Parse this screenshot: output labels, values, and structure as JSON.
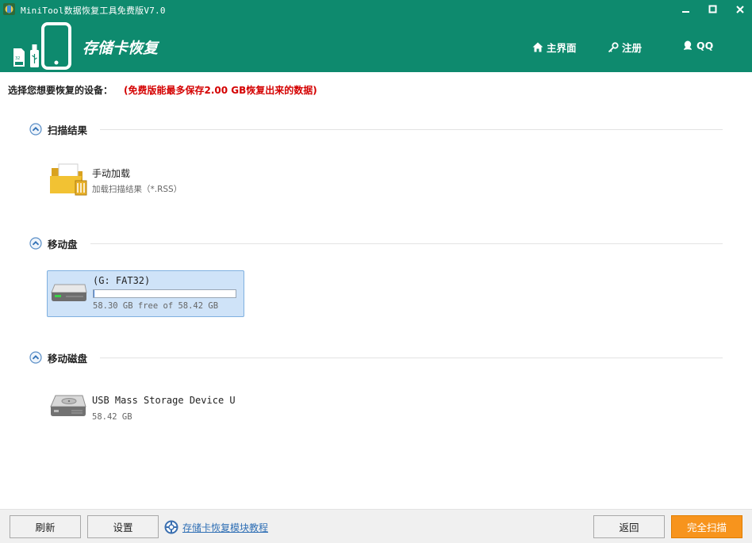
{
  "window": {
    "title": "MiniTool数据恢复工具免费版V7.0"
  },
  "header": {
    "app_title": "存储卡恢复",
    "nav": {
      "home": "主界面",
      "register": "注册",
      "qq": "QQ"
    }
  },
  "prompt": {
    "label": "选择您想要恢复的设备：",
    "limit_notice": "(免费版能最多保存2.00 GB恢复出来的数据)"
  },
  "sections": {
    "scan_results": {
      "title": "扫描结果",
      "item": {
        "name": "手动加载",
        "description": "加载扫描结果（*.RSS）",
        "icon": "folder-icon"
      }
    },
    "removable": {
      "title": "移动盘",
      "item": {
        "name": "(G: FAT32)",
        "usage": "58.30 GB free of 58.42 GB",
        "used_fraction": 0.002,
        "icon": "drive-icon"
      }
    },
    "removable_disk": {
      "title": "移动磁盘",
      "item": {
        "name": "USB Mass Storage Device U",
        "size": "58.42 GB",
        "icon": "disk-icon"
      }
    }
  },
  "footer": {
    "refresh": "刷新",
    "settings": "设置",
    "help_link": "存储卡恢复模块教程",
    "back": "返回",
    "full_scan": "完全扫描"
  },
  "colors": {
    "brand": "#0e8a6e",
    "warning": "#d40000",
    "selection": "#cfe3f8",
    "primary_button": "#f7941d",
    "link": "#2f6fb5"
  }
}
